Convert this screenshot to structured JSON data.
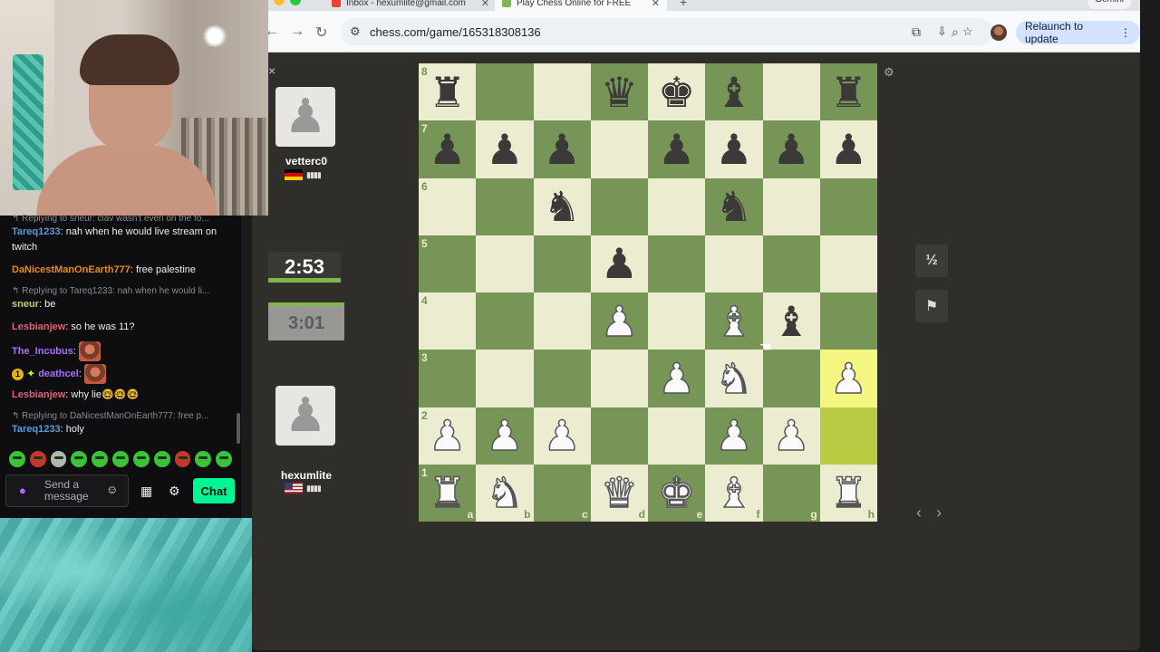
{
  "browser": {
    "tabs": [
      {
        "title": "Inbox - hexumlite@gmail.com"
      },
      {
        "title": "Play Chess Online for FREE"
      }
    ],
    "new_tab": "+",
    "gemini": "Gemini",
    "url": "chess.com/game/165318308136",
    "relaunch_label": "Relaunch to update"
  },
  "game": {
    "close_icon": "×",
    "top_player": {
      "name": "vetterc0",
      "flag": "de",
      "rating_bars": "▮▮▮▮",
      "clock": "2:53"
    },
    "bottom_player": {
      "name": "hexumlite",
      "flag": "us",
      "rating_bars": "▮▮▮▮",
      "clock": "3:01"
    },
    "draw_label": "½",
    "board": {
      "ranks": [
        "8",
        "7",
        "6",
        "5",
        "4",
        "3",
        "2",
        "1"
      ],
      "files": [
        "a",
        "b",
        "c",
        "d",
        "e",
        "f",
        "g",
        "h"
      ],
      "rows": [
        [
          "r",
          "",
          "",
          "q",
          "k",
          "b",
          "",
          "r"
        ],
        [
          "p",
          "p",
          "p",
          "",
          "p",
          "p",
          "p",
          "p"
        ],
        [
          "",
          "",
          "n",
          "",
          "",
          "n",
          "",
          ""
        ],
        [
          "",
          "",
          "",
          "p",
          "",
          "",
          "",
          ""
        ],
        [
          "",
          "",
          "",
          "P",
          "",
          "B",
          "b",
          ""
        ],
        [
          "",
          "",
          "",
          "",
          "P",
          "N",
          "",
          "P"
        ],
        [
          "P",
          "P",
          "P",
          "",
          "",
          "P",
          "P",
          ""
        ],
        [
          "R",
          "N",
          "",
          "Q",
          "K",
          "B",
          "",
          "R"
        ]
      ],
      "last_move": [
        "h2",
        "h3"
      ],
      "colors": {
        "light": "#ebecd0",
        "dark": "#779556",
        "highlight_light": "#f5f682",
        "highlight_dark": "#b9ca43"
      }
    }
  },
  "chat": {
    "messages": [
      {
        "type": "reply",
        "text": "↰ Replying to sneur: clav wasn't even on the fo..."
      },
      {
        "user": "Tareq1233",
        "color": "#5b9bd5",
        "text": "nah when he would live stream on twitch"
      },
      {
        "user": "DaNicestManOnEarth777",
        "color": "#e68a1f",
        "text": "free palestine"
      },
      {
        "type": "reply",
        "text": "↰ Replying to Tareq1233: nah when he would li..."
      },
      {
        "user": "sneur",
        "color": "#b4d46b",
        "text": "be"
      },
      {
        "user": "Lesbianjew",
        "color": "#e0627a",
        "text": "so he was 11?"
      },
      {
        "user": "The_Incubus",
        "color": "#a970ff",
        "text": ""
      },
      {
        "user": "deathcel",
        "color": "#a970ff",
        "text": "",
        "badge": "1"
      },
      {
        "user": "Lesbianjew",
        "color": "#e0627a",
        "text": "why lie🤓🤓🤓"
      },
      {
        "type": "reply",
        "text": "↰ Replying to DaNicestManOnEarth777: free p..."
      },
      {
        "user": "Tareq1233",
        "color": "#5b9bd5",
        "text": "holy"
      }
    ],
    "input_placeholder": "Send a message",
    "send_label": "Chat"
  }
}
